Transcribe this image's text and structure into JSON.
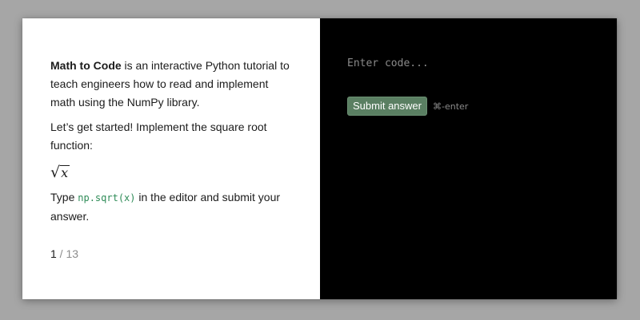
{
  "lesson": {
    "intro_brand": "Math to Code",
    "intro_text": " is an interactive Python tutorial to teach engineers how to read and implement math using the NumPy library.",
    "prompt": "Let’s get started! Implement the square root function:",
    "formula": {
      "radical": "√",
      "radicand": "x"
    },
    "instruction_before": "Type ",
    "instruction_code": "np.sqrt(x)",
    "instruction_after": " in the editor and submit your answer."
  },
  "pagination": {
    "current": "1",
    "separator": " / ",
    "total": "13"
  },
  "editor": {
    "placeholder": "Enter code...",
    "value": "",
    "submit_label": "Submit answer",
    "shortcut_hint": "⌘-enter"
  },
  "colors": {
    "page_background": "#a6a6a6",
    "editor_background": "#000000",
    "submit_button": "#5a7f62",
    "inline_code": "#2e8b57"
  }
}
